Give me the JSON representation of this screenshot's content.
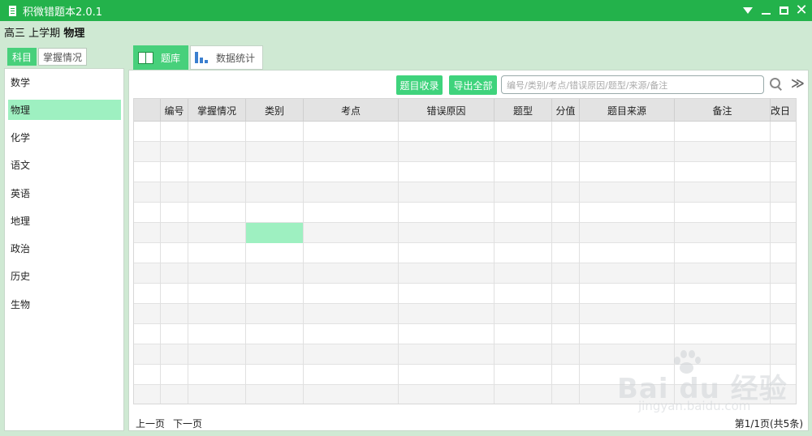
{
  "window": {
    "title": "积微错题本2.0.1"
  },
  "breadcrumb": {
    "grade": "高三",
    "term": "上学期",
    "subject": "物理"
  },
  "left_tabs": [
    {
      "label": "科目",
      "active": true
    },
    {
      "label": "掌握情况",
      "active": false
    }
  ],
  "subjects": [
    {
      "label": "数学",
      "active": false
    },
    {
      "label": "物理",
      "active": true
    },
    {
      "label": "化学",
      "active": false
    },
    {
      "label": "语文",
      "active": false
    },
    {
      "label": "英语",
      "active": false
    },
    {
      "label": "地理",
      "active": false
    },
    {
      "label": "政治",
      "active": false
    },
    {
      "label": "历史",
      "active": false
    },
    {
      "label": "生物",
      "active": false
    }
  ],
  "main_tabs": [
    {
      "label": "题库",
      "icon": "book-icon",
      "active": true
    },
    {
      "label": "数据统计",
      "icon": "bar-chart-icon",
      "active": false
    }
  ],
  "toolbar": {
    "collect_label": "题目收录",
    "export_label": "导出全部",
    "search_placeholder": "编号/类别/考点/错误原因/题型/来源/备注",
    "expand_symbol": "≫"
  },
  "table": {
    "columns": [
      "",
      "编号",
      "掌握情况",
      "类别",
      "考点",
      "错误原因",
      "题型",
      "分值",
      "题目来源",
      "备注",
      "改日"
    ],
    "row_count": 14,
    "selected_row": 5,
    "selected_col": 3
  },
  "pager": {
    "prev": "上一页",
    "next": "下一页",
    "info": "第1/1页(共5条)"
  },
  "watermark": {
    "logo": "Bai du 经验",
    "url": "jingyan.baidu.com"
  },
  "colors": {
    "titlebar": "#23b24b",
    "accent": "#47d07b",
    "selection": "#9ef0c1",
    "background": "#cfe9d3"
  }
}
